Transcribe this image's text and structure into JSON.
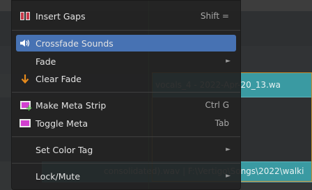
{
  "background": {
    "strip_top_text": "vocals_4 - 2022-Apr-20_13.wa",
    "strip_bottom_text": "consolidated).wav | F:\\Vertigo\\Songs\\2022\\walki"
  },
  "menu": {
    "items": [
      {
        "label": "Insert Gaps",
        "shortcut": "Shift =",
        "icon": "insert-gaps-icon"
      },
      {
        "label": "Crossfade Sounds",
        "shortcut": "",
        "icon": "speaker-icon",
        "active": true
      },
      {
        "label": "Fade",
        "submenu": true
      },
      {
        "label": "Clear Fade",
        "icon": "down-arrow-icon"
      },
      {
        "label": "Make Meta Strip",
        "shortcut": "Ctrl G",
        "icon": "meta-strip-add-icon"
      },
      {
        "label": "Toggle Meta",
        "shortcut": "Tab",
        "icon": "meta-strip-icon"
      },
      {
        "label": "Set Color Tag",
        "submenu": true
      },
      {
        "label": "Lock/Mute",
        "submenu": true
      }
    ],
    "submenu_arrow": "►"
  }
}
